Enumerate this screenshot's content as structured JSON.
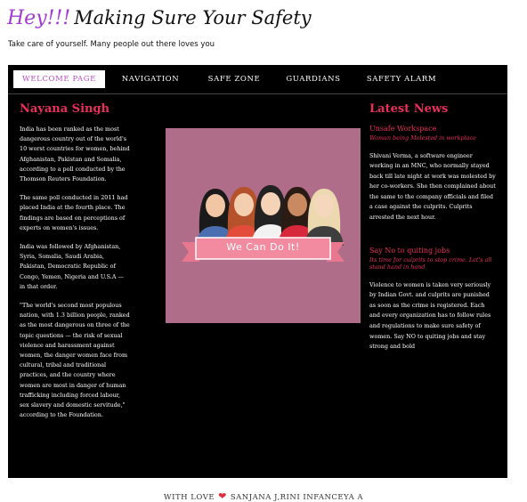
{
  "header": {
    "brand_hey": "Hey!!!",
    "brand_title": "Making Sure Your Safety",
    "tagline": "Take care of yourself. Many people out there loves you"
  },
  "nav": {
    "items": [
      {
        "label": "WELCOME PAGE"
      },
      {
        "label": "NAVIGATION"
      },
      {
        "label": "SAFE ZONE"
      },
      {
        "label": "GUARDIANS"
      },
      {
        "label": "SAFETY ALARM"
      }
    ]
  },
  "left": {
    "heading": "Nayana Singh",
    "paragraphs": [
      "India has been ranked as the most dangerous country out of the world's 10 worst countries for women, behind Afghanistan, Pakistan and Somalia, according to a poll conducted by the Thomson Reuters Foundation.",
      "The same poll conducted in 2011 had placed India at the fourth place. The findings are based on perceptions of experts on women's issues.",
      "India was followed by Afghanistan, Syria, Somalia, Saudi Arabia, Pakistan, Democratic Republic of Congo, Yemen, Nigeria and U.S.A — in that order.",
      "\"The world's second most populous nation, with 1.3 billion people, ranked as the most dangerous on three of the topic questions — the risk of sexual violence and harassment against women, the danger women face from cultural, tribal and traditional practices, and the country where women are most in danger of human trafficking including forced labour, sex slavery and domestic servitude,\" according to the Foundation."
    ]
  },
  "poster": {
    "banner_text": "We Can Do It!",
    "bg_color": "#b06d89"
  },
  "news": {
    "heading": "Latest News",
    "items": [
      {
        "title": "Unsafe Workspace",
        "subtitle": "Woman being Molested in workplace",
        "body": "Shivani Verma, a software engineer working in an MNC, who normally stayed back till late night at work was molested by her co-workers. She then complained about the same to the company officials and filed a case against the culprits. Culprits arrested the next hour."
      },
      {
        "title": "Say No to quiting jobs",
        "subtitle": "Its time for culprits to stop crime. Let's all stand hand in hand",
        "body": "Violence to women is taken very seriously by Indian Govt. and culprits are punished as soon as the crime is registered. Each and every organization has to follow rules and regulations to make sure safety of women. Say NO to quiting jobs and stay strong and bold"
      }
    ]
  },
  "footer": {
    "prefix": "WITH LOVE",
    "heart_icon": "heart-icon",
    "authors": "SANJANA J,RINI INFANCEYA A"
  },
  "colors": {
    "accent": "#e8305a",
    "brand_purple": "#a23bd1",
    "active_nav_text": "#b84ec4",
    "panel_bg": "#000000"
  }
}
